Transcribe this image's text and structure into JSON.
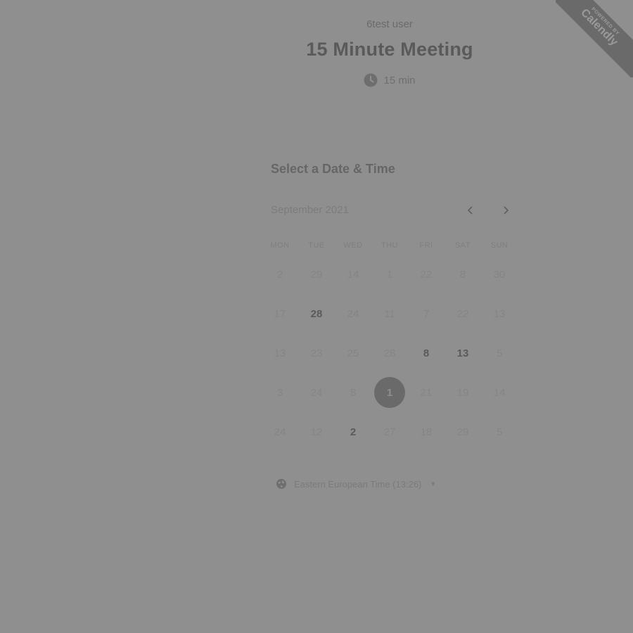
{
  "header": {
    "owner": "6test user",
    "title": "15 Minute Meeting",
    "duration": "15 min",
    "duration_icon": "clock-icon"
  },
  "scheduler": {
    "heading": "Select a Date & Time",
    "month_label": "September 2021",
    "prev_icon": "chevron-left-icon",
    "next_icon": "chevron-right-icon",
    "weekdays": [
      "MON",
      "TUE",
      "WED",
      "THU",
      "FRI",
      "SAT",
      "SUN"
    ],
    "weeks": [
      [
        {
          "d": "2"
        },
        {
          "d": "29"
        },
        {
          "d": "14"
        },
        {
          "d": "1"
        },
        {
          "d": "22"
        },
        {
          "d": "8"
        },
        {
          "d": "30"
        }
      ],
      [
        {
          "d": "17"
        },
        {
          "d": "28",
          "state": "available"
        },
        {
          "d": "24"
        },
        {
          "d": "11"
        },
        {
          "d": "7"
        },
        {
          "d": "22"
        },
        {
          "d": "13"
        }
      ],
      [
        {
          "d": "13"
        },
        {
          "d": "23"
        },
        {
          "d": "25"
        },
        {
          "d": "28"
        },
        {
          "d": "8",
          "state": "available"
        },
        {
          "d": "13",
          "state": "available"
        },
        {
          "d": "5"
        }
      ],
      [
        {
          "d": "3"
        },
        {
          "d": "24"
        },
        {
          "d": "8"
        },
        {
          "d": "1",
          "state": "selected"
        },
        {
          "d": "21"
        },
        {
          "d": "19"
        },
        {
          "d": "14"
        }
      ],
      [
        {
          "d": "24"
        },
        {
          "d": "12"
        },
        {
          "d": "2",
          "state": "available"
        },
        {
          "d": "27"
        },
        {
          "d": "18"
        },
        {
          "d": "29"
        },
        {
          "d": "5"
        }
      ]
    ]
  },
  "timezone": {
    "label": "Eastern European Time (13:26)",
    "icon": "globe-icon"
  },
  "branding": {
    "small": "POWERED BY",
    "name": "Calendly"
  },
  "colors": {
    "overlay": "#8f8f8f",
    "selected_day": "#6a6a6a"
  }
}
